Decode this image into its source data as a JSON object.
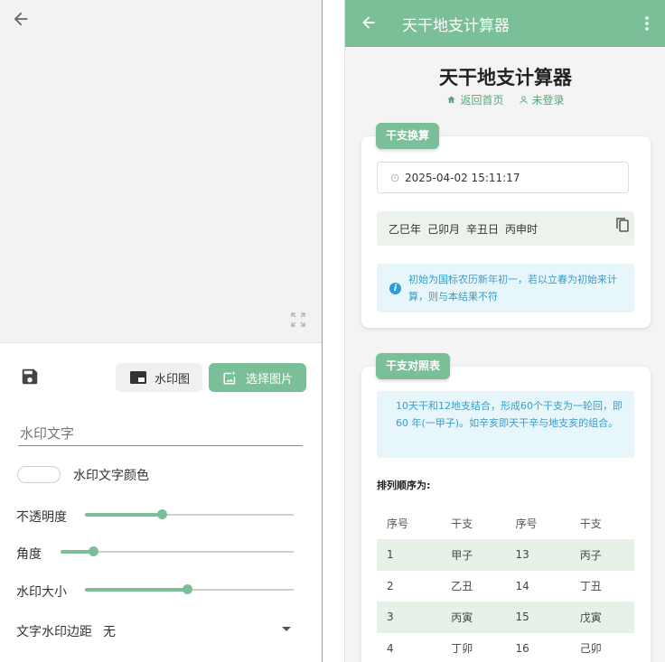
{
  "left": {
    "watermark_image_label": "水印图",
    "choose_image_label": "选择图片",
    "watermark_text_placeholder": "水印文字",
    "text_color_label": "水印文字颜色",
    "sliders": [
      {
        "label": "不透明度",
        "value": 0.37
      },
      {
        "label": "角度",
        "value": 0.14
      },
      {
        "label": "水印大小",
        "value": 0.49
      }
    ],
    "margin": {
      "label": "文字水印边距",
      "value": "无"
    }
  },
  "right": {
    "appbar_title": "天干地支计算器",
    "page_title": "天干地支计算器",
    "nav": {
      "home": "返回首页",
      "user": "未登录"
    },
    "convert_card": {
      "tag": "干支换算",
      "datetime": "2025-04-02 15:11:17",
      "result": [
        "乙巳年",
        "己卯月",
        "辛丑日",
        "丙申时"
      ],
      "info": "初始为国标农历新年初一，若以立春为初始来计算，则与本结果不符"
    },
    "table_card": {
      "tag": "干支对照表",
      "description": "10天干和12地支结合，形成60个干支为一轮回，即 60 年(一甲子)。如辛亥即天干辛与地支亥的组合。",
      "order_label": "排列顺序为:",
      "headers": [
        "序号",
        "干支",
        "序号",
        "干支"
      ],
      "rows": [
        [
          "1",
          "甲子",
          "13",
          "丙子"
        ],
        [
          "2",
          "乙丑",
          "14",
          "丁丑"
        ],
        [
          "3",
          "丙寅",
          "15",
          "戊寅"
        ],
        [
          "4",
          "丁卯",
          "16",
          "己卯"
        ]
      ]
    }
  },
  "colors": {
    "accent": "#7bbf98",
    "info_text": "#3a9cc9",
    "info_bg": "#e6f6fa",
    "row_alt": "#e6f2e8"
  }
}
